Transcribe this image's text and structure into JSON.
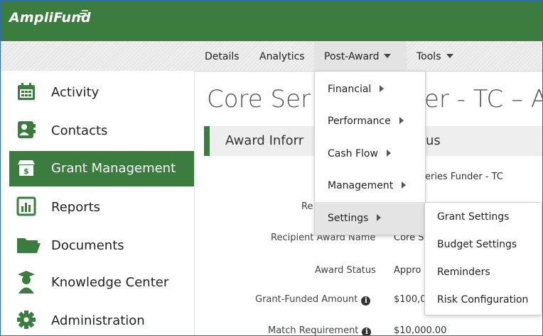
{
  "app": {
    "logo_text": "AmpliFund"
  },
  "nav": {
    "tabs": [
      {
        "label": "Details"
      },
      {
        "label": "Analytics"
      },
      {
        "label": "Post-Award"
      },
      {
        "label": "Tools"
      }
    ]
  },
  "sidebar": {
    "items": [
      {
        "label": "Activity",
        "icon": "calendar-icon"
      },
      {
        "label": "Contacts",
        "icon": "contact-card-icon"
      },
      {
        "label": "Grant Management",
        "icon": "grant-box-icon",
        "active": true
      },
      {
        "label": "Reports",
        "icon": "bar-chart-icon"
      },
      {
        "label": "Documents",
        "icon": "folder-icon"
      },
      {
        "label": "Knowledge Center",
        "icon": "graduate-icon"
      },
      {
        "label": "Administration",
        "icon": "gear-icon"
      }
    ]
  },
  "main": {
    "title_left": "Core Ser",
    "title_right": "er - TC – A",
    "section_left": "Award Inforr",
    "section_right": "us",
    "funder_value": "eries Funder - TC",
    "partial_label": "Re",
    "fields": [
      {
        "label": "Recipient Award Name",
        "value": "Core S"
      },
      {
        "label": "Award Status",
        "value": "Appro"
      },
      {
        "label": "Grant-Funded Amount",
        "value": "$100,0",
        "info": true
      },
      {
        "label": "Match Requirement",
        "value": "$10,000.00",
        "info": true
      }
    ]
  },
  "post_award_menu": {
    "items": [
      {
        "label": "Financial"
      },
      {
        "label": "Performance"
      },
      {
        "label": "Cash Flow"
      },
      {
        "label": "Management"
      },
      {
        "label": "Settings",
        "active": true
      }
    ]
  },
  "settings_submenu": {
    "items": [
      {
        "label": "Grant Settings"
      },
      {
        "label": "Budget Settings"
      },
      {
        "label": "Reminders"
      },
      {
        "label": "Risk Configuration"
      }
    ]
  },
  "colors": {
    "brand_green": "#3a7d3e",
    "menu_hover": "#e5e5e5"
  }
}
